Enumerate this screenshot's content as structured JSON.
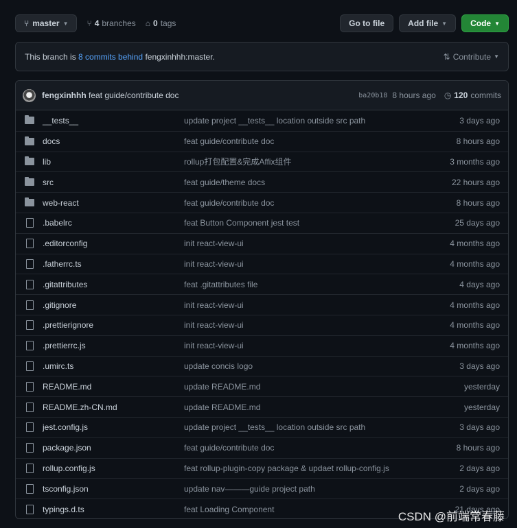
{
  "toolbar": {
    "branch": "master",
    "branches_count": "4",
    "branches_label": "branches",
    "tags_count": "0",
    "tags_label": "tags",
    "go_to_file": "Go to file",
    "add_file": "Add file",
    "code": "Code"
  },
  "notice": {
    "prefix": "This branch is",
    "link": "8 commits behind",
    "suffix": "fengxinhhh:master.",
    "contribute": "Contribute"
  },
  "latest_commit": {
    "author": "fengxinhhh",
    "message": "feat guide/contribute doc",
    "hash": "ba20b18",
    "age": "8 hours ago",
    "commits_count": "120",
    "commits_label": "commits"
  },
  "files": [
    {
      "type": "folder",
      "name": "__tests__",
      "message": "update project __tests__ location outside src path",
      "age": "3 days ago"
    },
    {
      "type": "folder",
      "name": "docs",
      "message": "feat guide/contribute doc",
      "age": "8 hours ago"
    },
    {
      "type": "folder",
      "name": "lib",
      "message": "rollup打包配置&完成Affix组件",
      "age": "3 months ago"
    },
    {
      "type": "folder",
      "name": "src",
      "message": "feat guide/theme docs",
      "age": "22 hours ago"
    },
    {
      "type": "folder",
      "name": "web-react",
      "message": "feat guide/contribute doc",
      "age": "8 hours ago"
    },
    {
      "type": "file",
      "name": ".babelrc",
      "message": "feat Button Component jest test",
      "age": "25 days ago"
    },
    {
      "type": "file",
      "name": ".editorconfig",
      "message": "init react-view-ui",
      "age": "4 months ago"
    },
    {
      "type": "file",
      "name": ".fatherrc.ts",
      "message": "init react-view-ui",
      "age": "4 months ago"
    },
    {
      "type": "file",
      "name": ".gitattributes",
      "message": "feat .gitattributes file",
      "age": "4 days ago"
    },
    {
      "type": "file",
      "name": ".gitignore",
      "message": "init react-view-ui",
      "age": "4 months ago"
    },
    {
      "type": "file",
      "name": ".prettierignore",
      "message": "init react-view-ui",
      "age": "4 months ago"
    },
    {
      "type": "file",
      "name": ".prettierrc.js",
      "message": "init react-view-ui",
      "age": "4 months ago"
    },
    {
      "type": "file",
      "name": ".umirc.ts",
      "message": "update concis logo",
      "age": "3 days ago"
    },
    {
      "type": "file",
      "name": "README.md",
      "message": "update README.md",
      "age": "yesterday"
    },
    {
      "type": "file",
      "name": "README.zh-CN.md",
      "message": "update README.md",
      "age": "yesterday"
    },
    {
      "type": "file",
      "name": "jest.config.js",
      "message": "update project __tests__ location outside src path",
      "age": "3 days ago"
    },
    {
      "type": "file",
      "name": "package.json",
      "message": "feat guide/contribute doc",
      "age": "8 hours ago"
    },
    {
      "type": "file",
      "name": "rollup.config.js",
      "message": "feat rollup-plugin-copy package & updaet rollup-config.js",
      "age": "2 days ago"
    },
    {
      "type": "file",
      "name": "tsconfig.json",
      "message": "update nav———guide project path",
      "age": "2 days ago"
    },
    {
      "type": "file",
      "name": "typings.d.ts",
      "message": "feat Loading Component",
      "age": "21 days ago"
    }
  ],
  "watermark": "CSDN @前端常春藤"
}
